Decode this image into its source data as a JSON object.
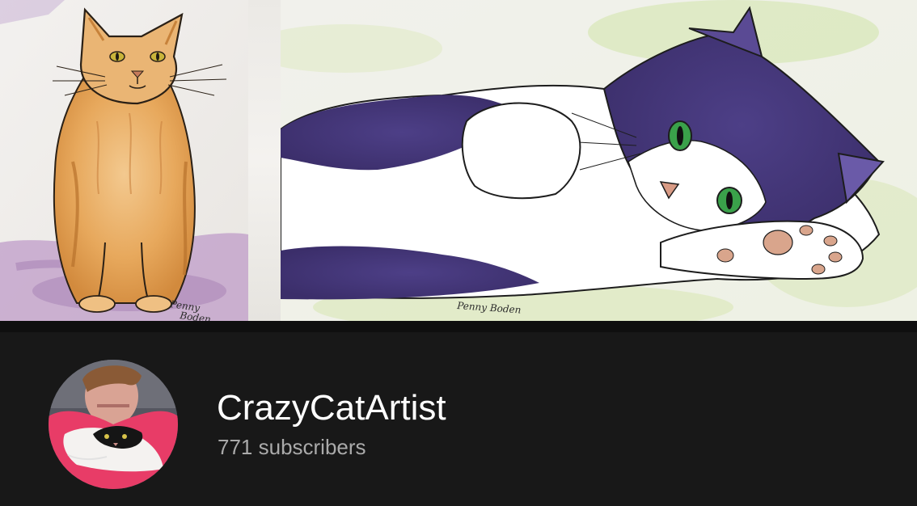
{
  "channel": {
    "name": "CrazyCatArtist",
    "subscribers": "771 subscribers"
  },
  "banner": {
    "left_artwork": {
      "subject": "orange cat sitting",
      "signature": [
        "Penny",
        "Boden"
      ]
    },
    "right_artwork": {
      "subject": "black and white cat lying",
      "signature": "Penny Boden"
    }
  },
  "colors": {
    "page_background": "#181818",
    "channel_name": "#ffffff",
    "subscriber_text": "#aaaaaa"
  }
}
